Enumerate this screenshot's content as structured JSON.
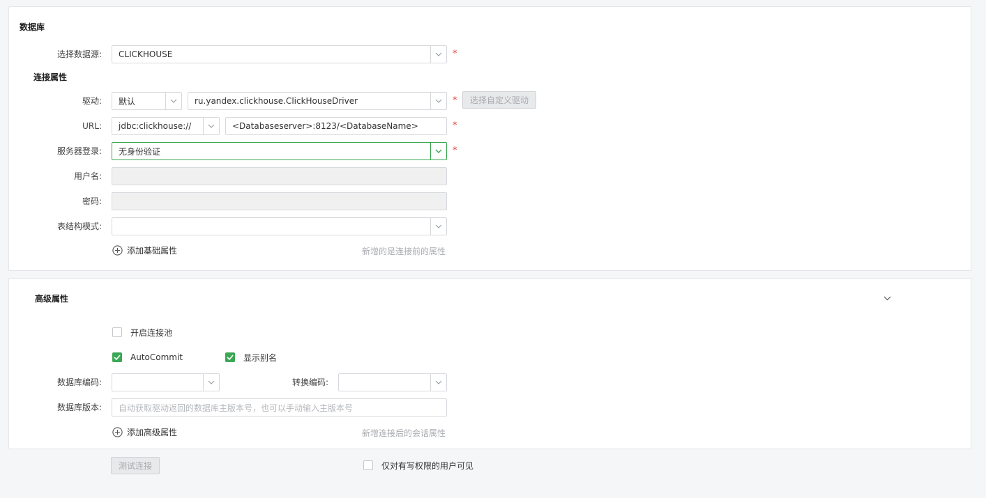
{
  "database": {
    "title": "数据库",
    "data_source": {
      "label": "选择数据源:",
      "value": "CLICKHOUSE"
    },
    "connection_title": "连接属性",
    "driver": {
      "label": "驱动:",
      "type_value": "默认",
      "class_value": "ru.yandex.clickhouse.ClickHouseDriver",
      "custom_button": "选择自定义驱动"
    },
    "url": {
      "label": "URL:",
      "prefix_value": "jdbc:clickhouse://",
      "value": "<Databaseserver>:8123/<DatabaseName>"
    },
    "server_login": {
      "label": "服务器登录:",
      "value": "无身份验证"
    },
    "username": {
      "label": "用户名:",
      "value": ""
    },
    "password": {
      "label": "密码:",
      "value": ""
    },
    "schema": {
      "label": "表结构模式:",
      "value": ""
    },
    "add_basic": "添加基础属性",
    "add_basic_hint": "新增的是连接前的属性",
    "required_mark": "*"
  },
  "advanced": {
    "title": "高级属性",
    "pool": {
      "label": "开启连接池",
      "checked": false
    },
    "autocommit": {
      "label": "AutoCommit",
      "checked": true
    },
    "show_alias": {
      "label": "显示别名",
      "checked": true
    },
    "db_encoding": {
      "label": "数据库编码:",
      "value": ""
    },
    "convert_encoding": {
      "label": "转换编码:",
      "value": ""
    },
    "db_version": {
      "label": "数据库版本:",
      "placeholder": "自动获取驱动返回的数据库主版本号，也可以手动输入主版本号"
    },
    "add_advanced": "添加高级属性",
    "add_advanced_hint": "新增连接后的会话属性"
  },
  "footer": {
    "test_button": "测试连接",
    "write_only": {
      "label": "仅对有写权限的用户可见",
      "checked": false
    }
  },
  "colors": {
    "accent": "#3ba755",
    "required": "#e0413b"
  },
  "icons": {
    "dropdown": "chevron-down-icon",
    "add": "plus-circle-icon",
    "check": "check-icon"
  }
}
